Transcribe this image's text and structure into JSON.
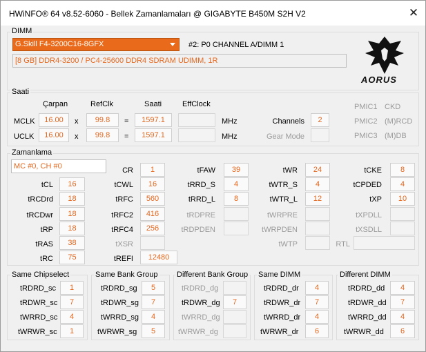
{
  "window": {
    "title": "HWiNFO® 64 v8.52-6060 - Bellek Zamanlamaları @ GIGABYTE B450M S2H V2",
    "close_glyph": "✕"
  },
  "dimm": {
    "group_label": "DIMM",
    "selected_module": "G.Skill F4-3200C16-8GFX",
    "slot": "#2: P0 CHANNEL A/DIMM 1",
    "description": "[8 GB] DDR4-3200 / PC4-25600 DDR4 SDRAM UDIMM, 1R",
    "logo_text": "AORUS",
    "logo_icon": "aorus-eagle-logo"
  },
  "clock": {
    "group_label": "Saati",
    "headers": {
      "multiplier": "Çarpan",
      "refclk": "RefClk",
      "clock": "Saati",
      "effclock": "EffClock"
    },
    "mclk": {
      "label": "MCLK",
      "multiplier": "16.00",
      "x": "x",
      "refclk": "99.8",
      "eq": "=",
      "clock": "1597.1",
      "effclock": "",
      "unit": "MHz"
    },
    "uclk": {
      "label": "UCLK",
      "multiplier": "16.00",
      "x": "x",
      "refclk": "99.8",
      "eq": "=",
      "clock": "1597.1",
      "effclock": "",
      "unit": "MHz"
    },
    "channels_label": "Channels",
    "channels_value": "2",
    "gear_mode_label": "Gear Mode",
    "gear_mode_value": "",
    "pmic": {
      "pmic1": "PMIC1",
      "pmic1_val": "CKD",
      "pmic2": "PMIC2",
      "pmic2_val": "(M)RCD",
      "pmic3": "PMIC3",
      "pmic3_val": "(M)DB"
    }
  },
  "timing": {
    "group_label": "Zamanlama",
    "mc_field": "MC #0, CH #0",
    "cr": {
      "label": "CR",
      "value": "1"
    },
    "tcl": {
      "label": "tCL",
      "value": "16"
    },
    "trcdrd": {
      "label": "tRCDrd",
      "value": "18"
    },
    "trcdwr": {
      "label": "tRCDwr",
      "value": "18"
    },
    "trp": {
      "label": "tRP",
      "value": "18"
    },
    "tras": {
      "label": "tRAS",
      "value": "38"
    },
    "trc": {
      "label": "tRC",
      "value": "75"
    },
    "tcwl": {
      "label": "tCWL",
      "value": "16"
    },
    "trfc": {
      "label": "tRFC",
      "value": "560"
    },
    "trfc2": {
      "label": "tRFC2",
      "value": "416"
    },
    "trfc4": {
      "label": "tRFC4",
      "value": "256"
    },
    "txsr": {
      "label": "tXSR",
      "value": ""
    },
    "trefi": {
      "label": "tREFI",
      "value": "12480"
    },
    "tfaw": {
      "label": "tFAW",
      "value": "39"
    },
    "trrd_s": {
      "label": "tRRD_S",
      "value": "4"
    },
    "trrd_l": {
      "label": "tRRD_L",
      "value": "8"
    },
    "trdpre": {
      "label": "tRDPRE",
      "value": ""
    },
    "trdpden": {
      "label": "tRDPDEN",
      "value": ""
    },
    "twr": {
      "label": "tWR",
      "value": "24"
    },
    "twtr_s": {
      "label": "tWTR_S",
      "value": "4"
    },
    "twtr_l": {
      "label": "tWTR_L",
      "value": "12"
    },
    "twrpre": {
      "label": "tWRPRE",
      "value": ""
    },
    "twrpden": {
      "label": "tWRPDEN",
      "value": ""
    },
    "twtp": {
      "label": "tWTP",
      "value": ""
    },
    "tcke": {
      "label": "tCKE",
      "value": "8"
    },
    "tcpded": {
      "label": "tCPDED",
      "value": "4"
    },
    "txp": {
      "label": "tXP",
      "value": "10"
    },
    "txpdll": {
      "label": "tXPDLL",
      "value": ""
    },
    "txsdll": {
      "label": "tXSDLL",
      "value": ""
    },
    "rtl": {
      "label": "RTL",
      "value": ""
    }
  },
  "turnaround": {
    "same_chip": {
      "title": "Same Chipselect",
      "rows": [
        {
          "label": "tRDRD_sc",
          "value": "1"
        },
        {
          "label": "tRDWR_sc",
          "value": "7"
        },
        {
          "label": "tWRRD_sc",
          "value": "4"
        },
        {
          "label": "tWRWR_sc",
          "value": "1"
        }
      ]
    },
    "same_bank": {
      "title": "Same Bank Group",
      "rows": [
        {
          "label": "tRDRD_sg",
          "value": "5"
        },
        {
          "label": "tRDWR_sg",
          "value": "7"
        },
        {
          "label": "tWRRD_sg",
          "value": "4"
        },
        {
          "label": "tWRWR_sg",
          "value": "5"
        }
      ]
    },
    "diff_bank": {
      "title": "Different Bank Group",
      "rows": [
        {
          "label": "tRDRD_dg",
          "value": ""
        },
        {
          "label": "tRDWR_dg",
          "value": "7"
        },
        {
          "label": "tWRRD_dg",
          "value": ""
        },
        {
          "label": "tWRWR_dg",
          "value": ""
        }
      ]
    },
    "same_dimm": {
      "title": "Same DIMM",
      "rows": [
        {
          "label": "tRDRD_dr",
          "value": "4"
        },
        {
          "label": "tRDWR_dr",
          "value": "7"
        },
        {
          "label": "tWRRD_dr",
          "value": "4"
        },
        {
          "label": "tWRWR_dr",
          "value": "6"
        }
      ]
    },
    "diff_dimm": {
      "title": "Different DIMM",
      "rows": [
        {
          "label": "tRDRD_dd",
          "value": "4"
        },
        {
          "label": "tRDWR_dd",
          "value": "7"
        },
        {
          "label": "tWRRD_dd",
          "value": "4"
        },
        {
          "label": "tWRWR_dd",
          "value": "6"
        }
      ]
    }
  }
}
